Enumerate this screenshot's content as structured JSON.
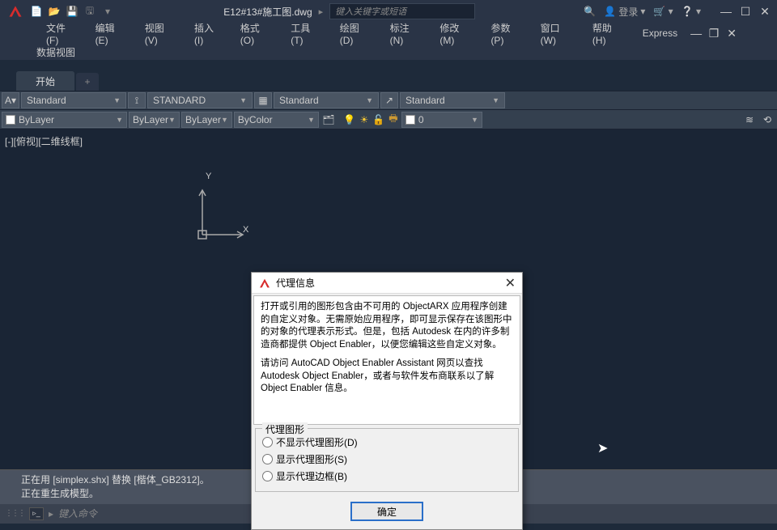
{
  "titlebar": {
    "doc_title": "E12#13#施工图.dwg",
    "share": "▸",
    "search_placeholder": "键入关键字或短语",
    "login": "登录"
  },
  "menu": {
    "items": [
      "文件(F)",
      "编辑(E)",
      "视图(V)",
      "插入(I)",
      "格式(O)",
      "工具(T)",
      "绘图(D)",
      "标注(N)",
      "修改(M)",
      "参数(P)",
      "窗口(W)",
      "帮助(H)",
      "Express"
    ],
    "workspace": "数据视图"
  },
  "tabs": {
    "start": "开始"
  },
  "toolbar1": {
    "c1": "Standard",
    "c2": "STANDARD",
    "c3": "Standard",
    "c4": "Standard"
  },
  "toolbar2": {
    "layer1": "ByLayer",
    "layer2": "ByLayer",
    "layer3": "ByLayer",
    "color": "ByColor",
    "layer0": "0"
  },
  "canvas": {
    "view_label": "[-][俯视][二维线框]",
    "y": "Y",
    "x": "X"
  },
  "dialog": {
    "title": "代理信息",
    "para1": "打开或引用的图形包含由不可用的 ObjectARX 应用程序创建的自定义对象。无需原始应用程序，即可显示保存在该图形中的对象的代理表示形式。但是，包括 Autodesk 在内的许多制造商都提供 Object Enabler，以便您编辑这些自定义对象。",
    "para2": "请访问 AutoCAD Object Enabler Assistant 网页以查找 Autodesk Object Enabler，或者与软件发布商联系以了解 Object Enabler 信息。",
    "group_title": "代理图形",
    "opt1": "不显示代理图形(D)",
    "opt2": "显示代理图形(S)",
    "opt3": "显示代理边框(B)",
    "ok": "确定"
  },
  "cmd": {
    "line1": "正在用 [simplex.shx] 替换 [楷体_GB2312]。",
    "line2": "正在重生成模型。",
    "placeholder": "键入命令"
  }
}
